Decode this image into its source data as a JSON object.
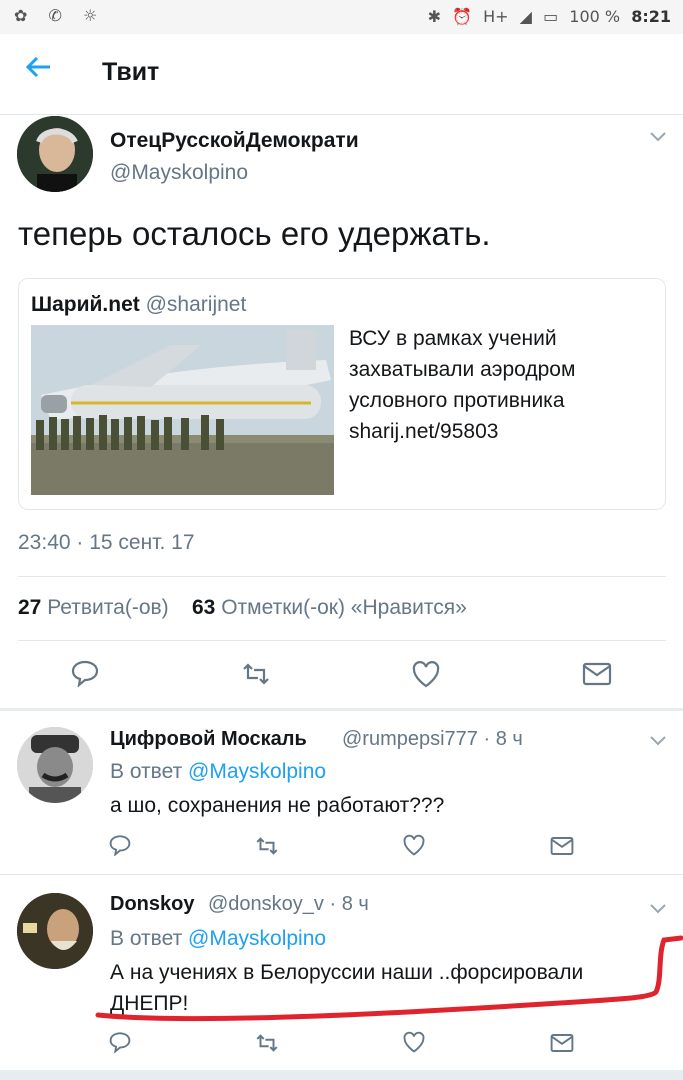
{
  "statusbar": {
    "battery": "100 %",
    "time": "8:21",
    "network_label": "H+"
  },
  "header": {
    "back_icon": "arrow-left-icon",
    "title": "Твит"
  },
  "tweet": {
    "author_name": "ОтецРусскойДемократи",
    "author_handle": "@Mayskolpino",
    "text": "теперь осталось его удержать.",
    "card": {
      "source_name": "Шарий.net",
      "source_handle": "@sharijnet",
      "text": "ВСУ в рамках учений захватывали аэродром условного противника sharij.net/95803"
    },
    "timestamp": "23:40 · 15 сент. 17",
    "retweets_count": "27",
    "retweets_label": "Ретвита(-ов)",
    "likes_count": "63",
    "likes_label": "Отметки(-ок) «Нравится»"
  },
  "replies": [
    {
      "name": "Цифровой Москаль",
      "handle": "@rumpepsi777 · 8 ч",
      "in_reply_prefix": "В ответ",
      "in_reply_to": "@Mayskolpino",
      "text": "а шо, сохранения не работают???"
    },
    {
      "name": "Donskoy",
      "handle": "@donskoy_v · 8 ч",
      "in_reply_prefix": "В ответ",
      "in_reply_to": "@Mayskolpino",
      "text": "А на учениях в Белоруссии наши ..форсировали ДНЕПР!"
    }
  ],
  "colors": {
    "accent": "#1da1f2",
    "secondary_text": "#657786",
    "annotation_stroke": "#e0242e"
  }
}
